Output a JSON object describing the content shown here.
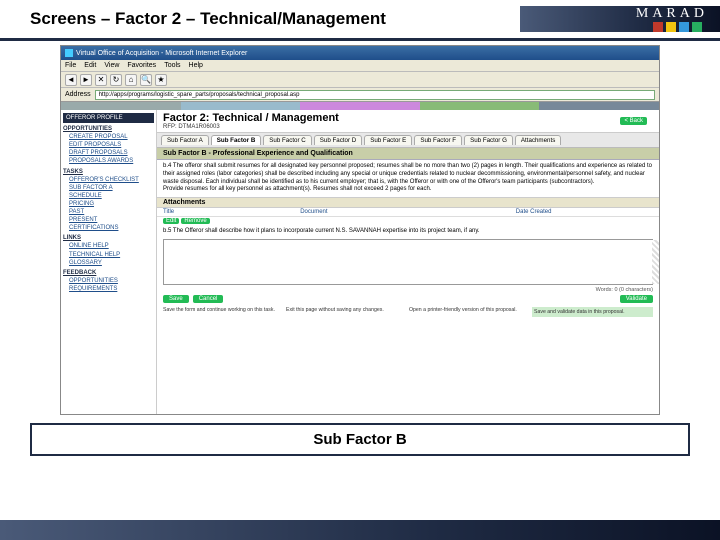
{
  "slide": {
    "title": "Screens – Factor 2 – Technical/Management",
    "brand": "MARAD",
    "caption": "Sub Factor B"
  },
  "ie": {
    "window_title": "Virtual Office of Acquisition - Microsoft Internet Explorer",
    "menu": [
      "File",
      "Edit",
      "View",
      "Favorites",
      "Tools",
      "Help"
    ],
    "address_label": "Address",
    "address_value": "http://apps/programs/logistic_spare_parts/proposals/technical_proposal.asp"
  },
  "sidebar": {
    "profile_hdr": "OFFEROR PROFILE",
    "groups": [
      {
        "label": "OPPORTUNITIES",
        "items": [
          "CREATE PROPOSAL",
          "EDIT PROPOSALS",
          "DRAFT PROPOSALS",
          "PROPOSALS AWARDS"
        ]
      },
      {
        "label": "TASKS",
        "items": [
          "OFFEROR'S CHECKLIST",
          "SUB FACTOR A",
          "SCHEDULE",
          "PRICING",
          "PAST",
          "PRESENT",
          "CERTIFICATIONS"
        ]
      },
      {
        "label": "LINKS",
        "items": [
          "ONLINE HELP",
          "TECHNICAL HELP",
          "GLOSSARY"
        ]
      },
      {
        "label": "FEEDBACK",
        "items": [
          "OPPORTUNITIES",
          "REQUIREMENTS"
        ]
      }
    ]
  },
  "main": {
    "factor_title": "Factor 2: Technical / Management",
    "rfp": "RFP: DTMA1R06003",
    "back": "< Back",
    "tabs": [
      "Sub Factor A",
      "Sub Factor B",
      "Sub Factor C",
      "Sub Factor D",
      "Sub Factor E",
      "Sub Factor F",
      "Sub Factor G",
      "Attachments"
    ],
    "active_tab_index": 1,
    "subfactor_heading": "Sub Factor B - Professional Experience and Qualification",
    "instruction_b4": "b.4 The offeror shall submit resumes for all designated key personnel proposed; resumes shall be no more than two (2) pages in length. Their qualifications and experience as related to their assigned roles (labor categories) shall be described including any special or unique credentials related to nuclear decommissioning, environmental/personnel safety, and nuclear waste disposal. Each individual shall be identified as to his current employer; that is, with the Offeror or with one of the Offeror's team participants (subcontractors).",
    "instruction_b4_line2": "Provide resumes for all key personnel as attachment(s). Resumes shall not exceed 2 pages for each.",
    "attachments": {
      "header": "Attachments",
      "cols": [
        "Title",
        "Document",
        "Date Created"
      ],
      "row_actions": [
        "Edit",
        "Remove"
      ]
    },
    "instruction_b5": "b.5 The Offeror shall describe how it plans to incorporate current N.S. SAVANNAH expertise into its project team, if any.",
    "editor_caption": "Words: 0 (0 characters)",
    "buttons": {
      "save": "Save",
      "cancel": "Cancel",
      "validate": "Validate"
    },
    "button_desc": {
      "save": "Save the form and continue working on this task.",
      "cancel": "Exit this page without saving any changes.",
      "open": "Open a printer-friendly version of this proposal.",
      "validate": "Save and validate data in this proposal."
    }
  }
}
